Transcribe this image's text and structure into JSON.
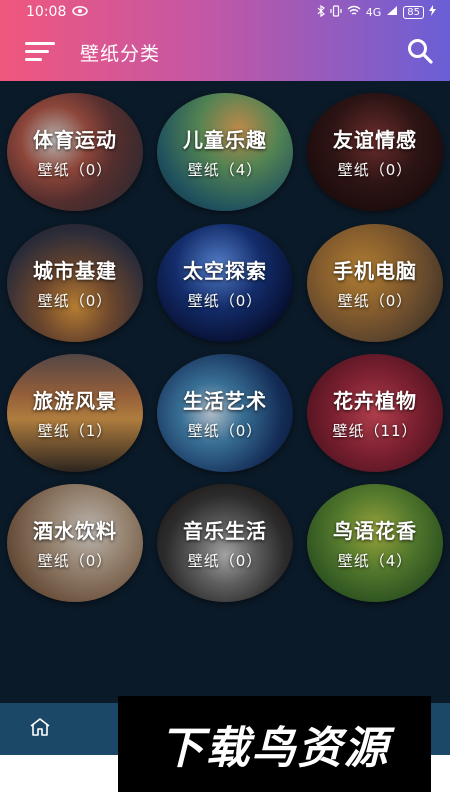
{
  "status_bar": {
    "time": "10:08",
    "network": "4G",
    "battery": "85"
  },
  "app_bar": {
    "title": "壁纸分类"
  },
  "categories": [
    {
      "name": "体育运动",
      "count": "壁纸（0）",
      "bg": "radial-gradient(circle at 35% 40%, #e8e4e0 0%, #b55a4a 30%, #6b3b3b 55%, #2c3440 100%)"
    },
    {
      "name": "儿童乐趣",
      "count": "壁纸（4）",
      "bg": "radial-gradient(circle at 60% 30%, #f0b060 0%, #6aa86a 35%, #2a6a7a 70%, #12303a 100%)"
    },
    {
      "name": "友谊情感",
      "count": "壁纸（0）",
      "bg": "radial-gradient(circle at 50% 40%, #8a3a3a 0%, #3a1a1a 45%, #150808 100%)"
    },
    {
      "name": "城市基建",
      "count": "壁纸（0）",
      "bg": "radial-gradient(circle at 50% 70%, #e8a040 0%, #8a5a3a 35%, #3a3a4a 70%, #1a2030 100%)"
    },
    {
      "name": "太空探索",
      "count": "壁纸（0）",
      "bg": "radial-gradient(circle at 45% 35%, #6aa0ff 0%, #1a3a8a 40%, #0a1540 75%, #050a20 100%)"
    },
    {
      "name": "手机电脑",
      "count": "壁纸（0）",
      "bg": "radial-gradient(circle at 40% 40%, #e0a040 0%, #b07a3a 35%, #7a5a3a 65%, #3a2e20 100%)"
    },
    {
      "name": "旅游风景",
      "count": "壁纸（1）",
      "bg": "linear-gradient(180deg, #6a5a5a 0%, #c07a4a 35%, #e0a050 55%, #3a3028 100%)"
    },
    {
      "name": "生活艺术",
      "count": "壁纸（0）",
      "bg": "radial-gradient(circle at 40% 50%, #e0f0ff 0%, #4a90c0 30%, #1a3a70 70%, #0a1a40 100%)"
    },
    {
      "name": "花卉植物",
      "count": "壁纸（11）",
      "bg": "radial-gradient(circle at 50% 50%, #e05060 0%, #a02a40 45%, #6a1a2a 80%, #3a0a18 100%)"
    },
    {
      "name": "酒水饮料",
      "count": "壁纸（0）",
      "bg": "radial-gradient(circle at 60% 40%, #f0e8e0 0%, #c0a890 35%, #8a6a50 70%, #4a3a2a 100%)"
    },
    {
      "name": "音乐生活",
      "count": "壁纸（0）",
      "bg": "radial-gradient(circle at 50% 60%, #d0d0d0 0%, #7a7a7a 30%, #3a3a3a 60%, #1a0a0a 100%)"
    },
    {
      "name": "鸟语花香",
      "count": "壁纸（4）",
      "bg": "radial-gradient(circle at 50% 40%, #c0d04a 0%, #6a9a3a 40%, #3a6a2a 75%, #1a3a18 100%)"
    }
  ],
  "watermark": {
    "text": "下载鸟资源"
  }
}
